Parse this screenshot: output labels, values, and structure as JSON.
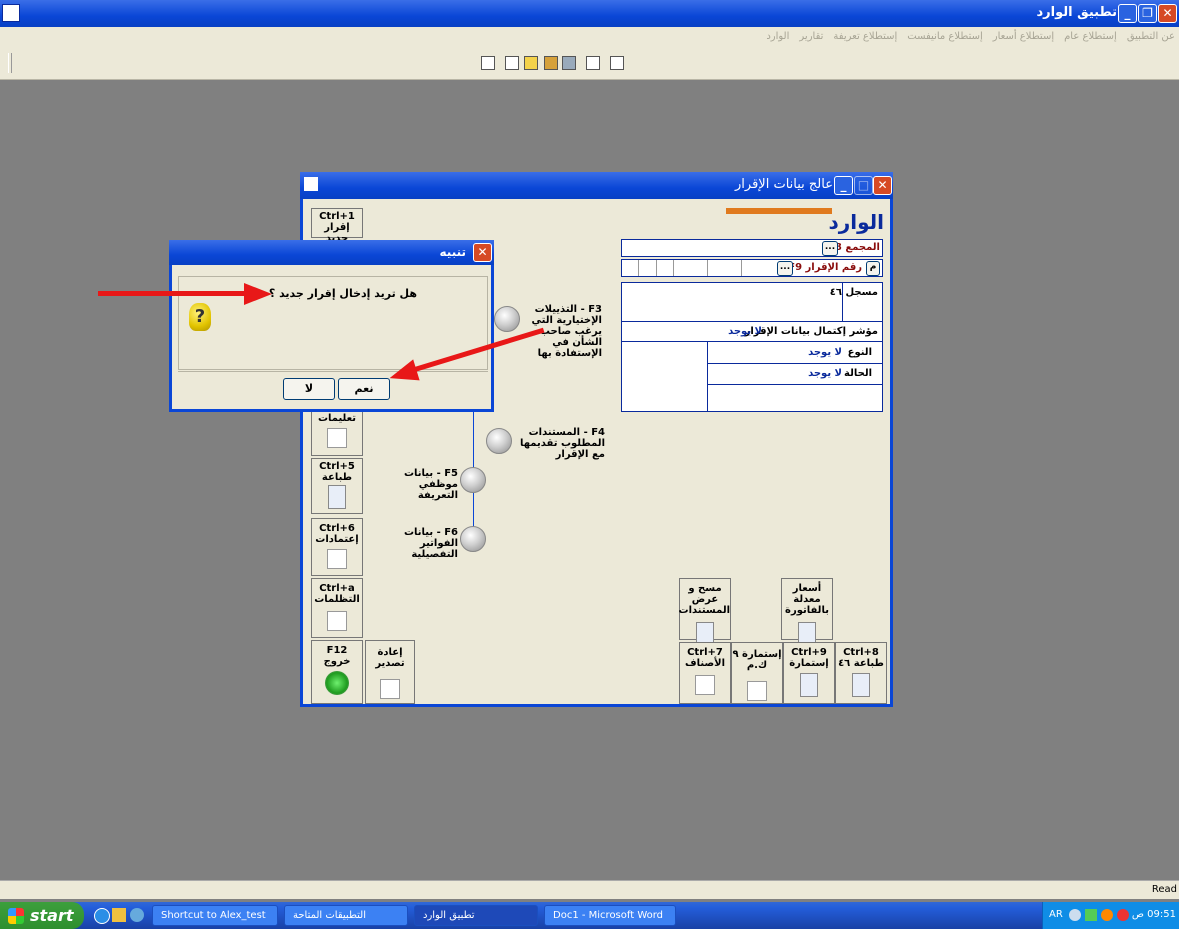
{
  "main_window": {
    "title": "تطبيق الوارد",
    "menu": [
      "الوارد",
      "تقارير",
      "إستطلاع تعريفة",
      "إستطلاع مانيفست",
      "إستطلاع أسعار",
      "إستطلاع عام",
      "عن التطبيق"
    ]
  },
  "inner_window": {
    "title": "عالج بيانات الإقرار",
    "header": "الوارد",
    "fields": {
      "majma_label": "المجمع F8",
      "majma_btn": "...",
      "raqm_label": "رقم الإقرار F9",
      "raqm_btn": "...",
      "mim": "م",
      "musajjal": "مسجل ٤٦",
      "completion_label": "مؤشر إكتمال بيانات الإقرار",
      "completion_value": "لا يوجد",
      "type_label": "النوع",
      "type_value": "لا يوجد",
      "status_label": "الحالة",
      "status_value": "لا يوجد"
    },
    "left_tools": {
      "new_key": "Ctrl+1",
      "new_label": "إقرار جديد",
      "instructions_label": "تعليمات",
      "print_key": "Ctrl+5",
      "print_label": "طباعة",
      "approvals_key": "Ctrl+6",
      "approvals_label": "إعتمادات",
      "grievances_key": "Ctrl+a",
      "grievances_label": "التظلمات",
      "exit_key": "F12",
      "exit_label": "خروج",
      "reissue_label": "إعادة تصدير"
    },
    "nodes": {
      "f3": "F3 - التذييلات الإختيارية التي يرغب صاحب الشأن في الإستفادة بها",
      "f4": "F4 - المستندات المطلوب تقديمها مع الإقرار",
      "f5": "F5 - بيانات موظفي التعريفة",
      "f6": "F6 - بيانات الفواتير التفصيلية"
    },
    "bottom_tools": {
      "scan_label": "مسح و عرض المستندات",
      "prices_label": "أسعار معدلة بالفاتورة",
      "items_key": "Ctrl+7",
      "items_label": "الأصناف",
      "form9_label": "إستمارة ٩ ك.م",
      "form_key": "Ctrl+9",
      "form_label": "إستمارة",
      "print46_key": "Ctrl+8",
      "print46_label": "طباعة ٤٦"
    }
  },
  "dialog": {
    "title": "تنبيه",
    "message": "هل تريد إدخال إقرار جديد ؟",
    "yes": "نعم",
    "no": "لا"
  },
  "status_bar": {
    "text": "Read"
  },
  "taskbar": {
    "start": "start",
    "tasks": [
      "Shortcut to Alex_test",
      "التطبيقات المتاحة",
      "تطبيق الوارد",
      "Doc1 - Microsoft Word"
    ],
    "lang": "AR",
    "clock": "09:51 ص"
  },
  "colors": {
    "titlebar": "#0a46d6",
    "arrow": "#e81818",
    "accent_bar": "#e07a1e",
    "desktop": "#808080"
  }
}
